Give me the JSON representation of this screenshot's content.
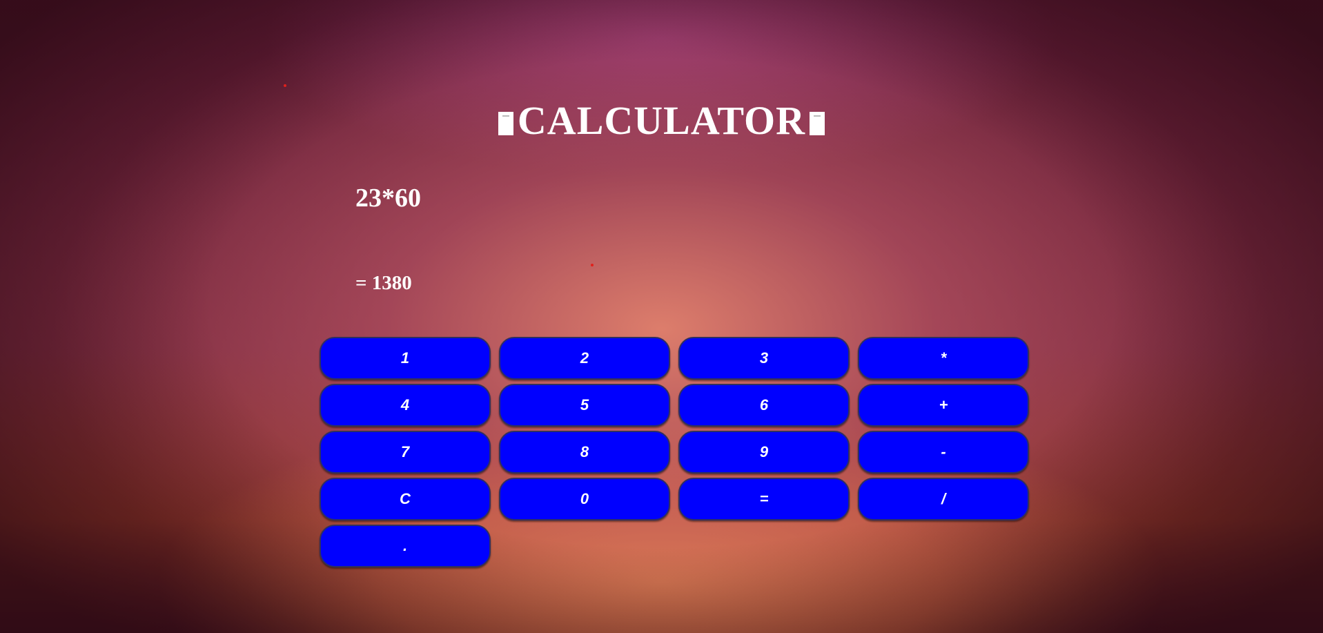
{
  "app": {
    "title": "CALCULATOR",
    "title_icon": "square-glyph-icon"
  },
  "display": {
    "expression": "23*60",
    "result": "= 1380"
  },
  "keys": [
    {
      "label": "1",
      "name": "key-1"
    },
    {
      "label": "2",
      "name": "key-2"
    },
    {
      "label": "3",
      "name": "key-3"
    },
    {
      "label": "*",
      "name": "key-multiply"
    },
    {
      "label": "4",
      "name": "key-4"
    },
    {
      "label": "5",
      "name": "key-5"
    },
    {
      "label": "6",
      "name": "key-6"
    },
    {
      "label": "+",
      "name": "key-add"
    },
    {
      "label": "7",
      "name": "key-7"
    },
    {
      "label": "8",
      "name": "key-8"
    },
    {
      "label": "9",
      "name": "key-9"
    },
    {
      "label": "-",
      "name": "key-subtract"
    },
    {
      "label": "C",
      "name": "key-clear"
    },
    {
      "label": "0",
      "name": "key-0"
    },
    {
      "label": "=",
      "name": "key-equals"
    },
    {
      "label": "/",
      "name": "key-divide"
    },
    {
      "label": ".",
      "name": "key-decimal"
    }
  ],
  "colors": {
    "key_background": "#0000ff",
    "key_text": "#ffffff",
    "text": "#ffffff",
    "dot": "#e0201c"
  }
}
